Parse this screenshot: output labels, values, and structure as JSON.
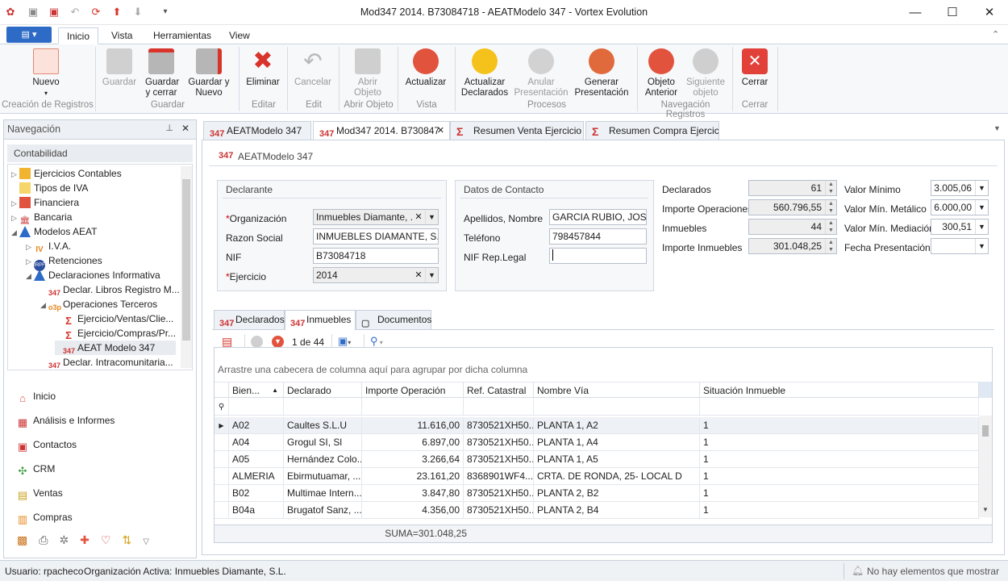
{
  "window": {
    "title": "Mod347 2014. B73084718 - AEATModelo 347 - Vortex Evolution"
  },
  "ribbon_tabs": [
    "Inicio",
    "Vista",
    "Herramientas",
    "View"
  ],
  "ribbon": {
    "buttons": {
      "nuevo": "Nuevo",
      "guardar": "Guardar",
      "guardar_cerrar": "Guardar y cerrar",
      "guardar_nuevo": "Guardar y Nuevo",
      "eliminar": "Eliminar",
      "cancelar": "Cancelar",
      "abrir_objeto": "Abrir Objeto",
      "actualizar": "Actualizar",
      "actualizar_declarados": "Actualizar Declarados",
      "anular_presentacion": "Anular Presentación",
      "generar_presentacion": "Generar Presentación",
      "objeto_anterior": "Objeto Anterior",
      "siguiente_objeto": "Siguiente objeto",
      "cerrar": "Cerrar"
    },
    "groups": {
      "creacion": "Creación de Registros",
      "guardar": "Guardar",
      "editar": "Editar",
      "edit": "Edit",
      "abrir": "Abrir Objeto",
      "vista": "Vista",
      "procesos": "Procesos",
      "navegacion": "Navegación Registros",
      "cerrar": "Cerrar"
    }
  },
  "nav": {
    "title": "Navegación",
    "section": "Contabilidad",
    "tree": [
      {
        "label": "Ejercicios Contables"
      },
      {
        "label": "Tipos de IVA"
      },
      {
        "label": "Financiera"
      },
      {
        "label": "Bancaria"
      },
      {
        "label": "Modelos AEAT"
      },
      {
        "label": "I.V.A."
      },
      {
        "label": "Retenciones"
      },
      {
        "label": "Declaraciones Informativa"
      },
      {
        "label": "Declar. Libros Registro M..."
      },
      {
        "label": "Operaciones Terceros"
      },
      {
        "label": "Ejercicio/Ventas/Clie..."
      },
      {
        "label": "Ejercicio/Compras/Pr..."
      },
      {
        "label": "AEAT Modelo 347"
      },
      {
        "label": "Declar. Intracomunitaria..."
      }
    ],
    "modules": [
      "Inicio",
      "Análisis e Informes",
      "Contactos",
      "CRM",
      "Ventas",
      "Compras"
    ]
  },
  "doc_tabs": [
    "AEATModelo 347",
    "Mod347 2014. B730847",
    "Resumen Venta Ejercicio",
    "Resumen Compra Ejercicio"
  ],
  "form": {
    "header": "AEATModelo 347",
    "declarante": {
      "legend": "Declarante",
      "organizacion_label": "Organización",
      "organizacion_value": "Inmuebles Diamante, ...",
      "razon_label": "Razon Social",
      "razon_value": "INMUEBLES DIAMANTE, S.L.",
      "nif_label": "NIF",
      "nif_value": "B73084718",
      "ejercicio_label": "Ejercicio",
      "ejercicio_value": "2014"
    },
    "contacto": {
      "legend": "Datos de Contacto",
      "apellidos_label": "Apellidos, Nombre",
      "apellidos_value": "GARCIA RUBIO, JOSE",
      "telefono_label": "Teléfono",
      "telefono_value": "798457844",
      "nifrep_label": "NIF Rep.Legal",
      "nifrep_value": ""
    },
    "totals": {
      "declarados_label": "Declarados",
      "declarados_value": "61",
      "importe_op_label": "Importe Operaciones",
      "importe_op_value": "560.796,55",
      "inmuebles_label": "Inmuebles",
      "inmuebles_value": "44",
      "importe_inm_label": "Importe Inmuebles",
      "importe_inm_value": "301.048,25"
    },
    "limits": {
      "valor_min_label": "Valor Mínimo",
      "valor_min_value": "3.005,06",
      "valor_metalico_label": "Valor Mín. Metálico",
      "valor_metalico_value": "6.000,00",
      "valor_mediacion_label": "Valor Mín. Mediación",
      "valor_mediacion_value": "300,51",
      "fecha_label": "Fecha Presentación",
      "fecha_value": ""
    }
  },
  "inner_tabs": [
    "Declarados",
    "Inmuebles",
    "Documentos"
  ],
  "grid": {
    "pager": "1 de 44",
    "group_hint": "Arrastre una cabecera de columna aquí para agrupar por dicha columna",
    "columns": [
      "Bien...",
      "Declarado",
      "Importe Operación",
      "Ref. Catastral",
      "Nombre Vía",
      "Situación Inmueble"
    ],
    "rows": [
      [
        "A02",
        "Caultes S.L.U",
        "11.616,00",
        "8730521XH50...",
        "PLANTA 1, A2",
        "1"
      ],
      [
        "A04",
        "Grogul SI, Sl",
        "6.897,00",
        "8730521XH50...",
        "PLANTA 1, A4",
        "1"
      ],
      [
        "A05",
        "Hernández Colo...",
        "3.266,64",
        "8730521XH50...",
        "PLANTA 1, A5",
        "1"
      ],
      [
        "ALMERIA",
        "Ebirmutuamar, ...",
        "23.161,20",
        "8368901WF4...",
        "CRTA. DE RONDA, 25- LOCAL D",
        "1"
      ],
      [
        "B02",
        "Multimae Intern...",
        "3.847,80",
        "8730521XH50...",
        "PLANTA 2, B2",
        "1"
      ],
      [
        "B04a",
        "Brugatof Sanz, ...",
        "4.356,00",
        "8730521XH50...",
        "PLANTA 2, B4",
        "1"
      ]
    ],
    "summary": "SUMA=301.048,25"
  },
  "status": {
    "user": "Usuario: rpacheco",
    "org": "Organización Activa: Inmuebles Diamante, S.L.",
    "alerts": "No hay elementos que mostrar"
  },
  "colors": {
    "accent": "#2e6bc6",
    "red": "#d9342b",
    "orange": "#e8861a"
  }
}
